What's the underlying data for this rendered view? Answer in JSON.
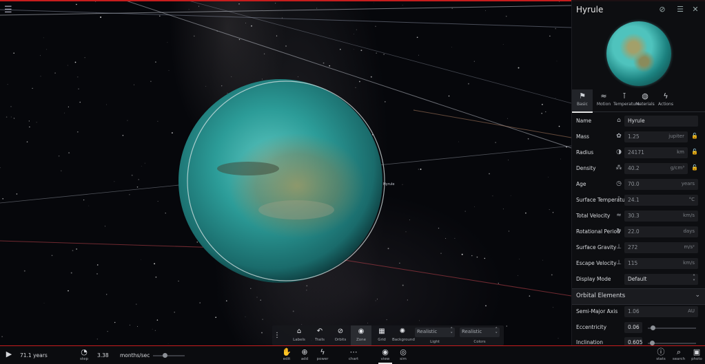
{
  "object": {
    "name": "Hyrule"
  },
  "panel": {
    "title": "Hyrule",
    "tabs": [
      "Basic",
      "Motion",
      "Temperature",
      "Materials",
      "Actions"
    ],
    "rows": [
      {
        "label": "Name",
        "value": "Hyrule",
        "unit": ""
      },
      {
        "label": "Mass",
        "value": "1.25",
        "unit": "jupiter"
      },
      {
        "label": "Radius",
        "value": "24171",
        "unit": "km"
      },
      {
        "label": "Density",
        "value": "40.2",
        "unit": "g/cm³"
      },
      {
        "label": "Age",
        "value": "70.0",
        "unit": "years"
      },
      {
        "label": "Surface Temperature",
        "value": "24.1",
        "unit": "°C"
      },
      {
        "label": "Total Velocity",
        "value": "30.3",
        "unit": "km/s"
      },
      {
        "label": "Rotational Period",
        "value": "22.0",
        "unit": "days"
      },
      {
        "label": "Surface Gravity",
        "value": "272",
        "unit": "m/s²"
      },
      {
        "label": "Escape Velocity",
        "value": "115",
        "unit": "km/s"
      },
      {
        "label": "Display Mode",
        "value": "Default",
        "unit": ""
      }
    ],
    "section": "Orbital Elements",
    "orbital": [
      {
        "label": "Semi-Major Axis",
        "value": "1.06",
        "unit": "AU"
      },
      {
        "label": "Eccentricity",
        "value": "0.06",
        "level": 0.06
      },
      {
        "label": "Inclination",
        "value": "0.605",
        "level": 0.04
      }
    ]
  },
  "toolbar": {
    "items": [
      "Labels",
      "Trails",
      "Orbits",
      "Zone",
      "Grid",
      "Background"
    ],
    "light": {
      "value": "Realistic",
      "caption": "Light"
    },
    "colors": {
      "value": "Realistic",
      "caption": "Colors"
    }
  },
  "bottom": {
    "time": "71.1 years",
    "step_label": "step",
    "step_value": "3.38",
    "rate_unit": "months/sec",
    "tools": [
      "edit",
      "add",
      "power",
      "chart",
      "view",
      "sim"
    ],
    "right_tools": [
      "stats",
      "search",
      "photo"
    ]
  },
  "scene": {
    "planet_label": "Hyrule"
  },
  "colors": {
    "accent_red": "#c71d1d",
    "planet_teal": "#3fb8b2"
  }
}
